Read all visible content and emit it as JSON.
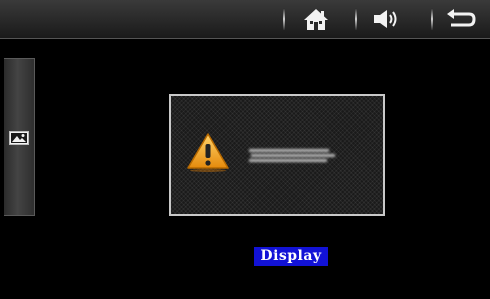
{
  "top_bar": {
    "buttons": [
      {
        "name": "home",
        "icon": "home-icon"
      },
      {
        "name": "volume",
        "icon": "speaker-icon"
      },
      {
        "name": "back",
        "icon": "return-arrow-icon"
      }
    ]
  },
  "side_tab": {
    "icon": "picture-icon"
  },
  "dialog": {
    "icon": "warning-icon",
    "message": ""
  },
  "status_label": "Display",
  "colors": {
    "label_bg": "#1212d6",
    "warning": "#f5a623",
    "dialog_border": "#c9c9c9"
  }
}
